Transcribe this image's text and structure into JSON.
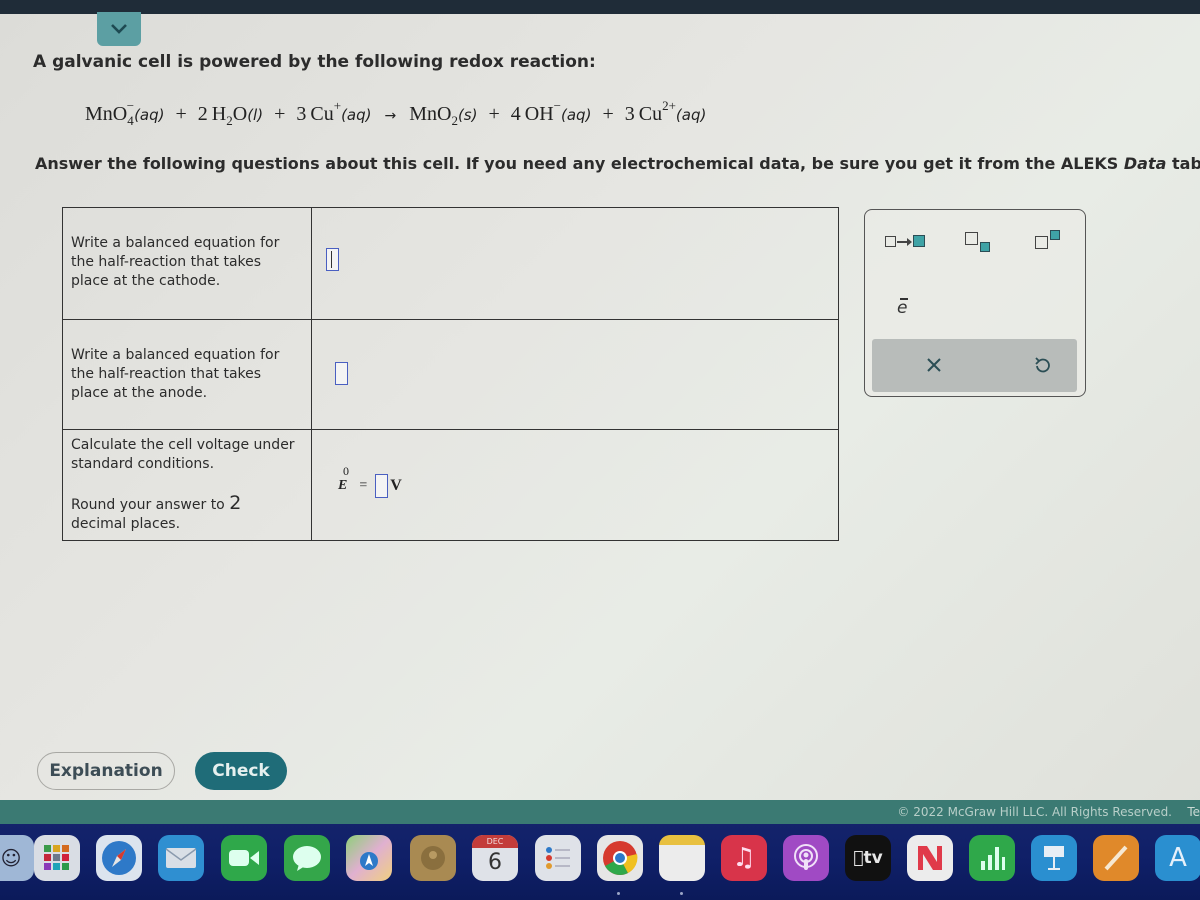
{
  "header": {
    "collapse_icon": "chevron-down-icon"
  },
  "problem": {
    "intro": "A galvanic cell is powered by the following redox reaction:",
    "equation": {
      "reactants": [
        {
          "coef": "",
          "formula": "MnO",
          "sub": "4",
          "sup": "−",
          "state": "(aq)"
        },
        {
          "coef": "2",
          "formula": "H",
          "sub": "2",
          "tail": "O",
          "sup": "",
          "state": "(l)"
        },
        {
          "coef": "3",
          "formula": "Cu",
          "sub": "",
          "sup": "+",
          "state": "(aq)"
        }
      ],
      "arrow": "→",
      "products": [
        {
          "coef": "",
          "formula": "MnO",
          "sub": "2",
          "sup": "",
          "state": "(s)"
        },
        {
          "coef": "4",
          "formula": "OH",
          "sub": "",
          "sup": "−",
          "state": "(aq)"
        },
        {
          "coef": "3",
          "formula": "Cu",
          "sub": "",
          "sup": "2+",
          "state": "(aq)"
        }
      ],
      "plus": "+"
    },
    "instructions_before": "Answer the following questions about this cell. If you need any electrochemical data, be sure you get it from the ALEKS ",
    "instructions_italic": "Data",
    "instructions_after": " tab."
  },
  "questions": [
    {
      "prompt": "Write a balanced equation for the half-reaction that takes place at the cathode.",
      "answer": ""
    },
    {
      "prompt": "Write a balanced equation for the half-reaction that takes place at the anode.",
      "answer": ""
    },
    {
      "prompt": "Calculate the cell voltage under standard conditions.",
      "round_text": "Round your answer to ",
      "round_digits": "2",
      "round_suffix": "decimal places.",
      "formula_symbol": "E",
      "formula_sup": "0",
      "formula_eq": "=",
      "formula_unit": "V",
      "answer": ""
    }
  ],
  "palette": {
    "buttons": [
      {
        "name": "reaction-arrow-template",
        "icon": "box-arrow-box-icon"
      },
      {
        "name": "subscript-template",
        "icon": "subscript-icon"
      },
      {
        "name": "superscript-template",
        "icon": "superscript-icon"
      }
    ],
    "electron_label": "e",
    "clear_icon": "x-icon",
    "undo_icon": "undo-icon"
  },
  "actions": {
    "explanation_label": "Explanation",
    "check_label": "Check"
  },
  "footer": {
    "copyright": "© 2022 McGraw Hill LLC. All Rights Reserved.",
    "terms_partial": "Te"
  },
  "dock": {
    "calendar_month": "DEC",
    "calendar_day": "6",
    "tv_label": "tv",
    "apps": [
      "Finder",
      "Launchpad",
      "Safari",
      "Mail",
      "FaceTime",
      "Messages",
      "Maps",
      "Contacts",
      "Calendar",
      "Reminders",
      "Chrome",
      "Notes",
      "Music",
      "Podcasts",
      "TV",
      "News",
      "Numbers",
      "Keynote",
      "Pages",
      "App Store"
    ]
  }
}
